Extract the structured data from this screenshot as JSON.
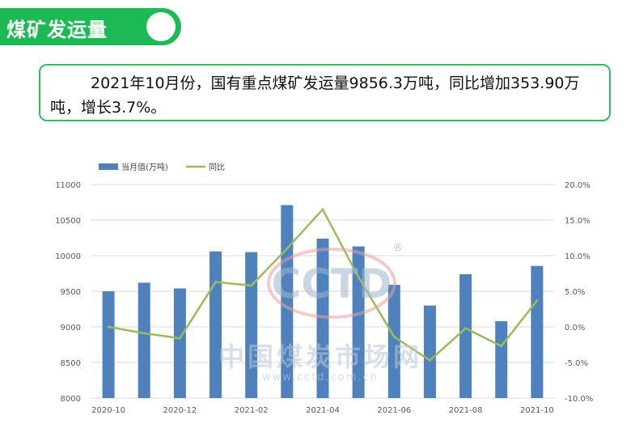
{
  "header": {
    "title": "煤矿发运量"
  },
  "summary": {
    "text": "2021年10月份，国有重点煤矿发运量9856.3万吨，同比增加353.90万吨，增长3.7%。"
  },
  "watermark": {
    "logo_text": "CCTD",
    "registered_mark": "®",
    "cn_text": "中国煤炭市场网",
    "url": "www.cctd.com.cn"
  },
  "colors": {
    "brand_green": "#1db954",
    "bar_blue": "#4f81bd",
    "line_green": "#9bbb59"
  },
  "chart_data": {
    "type": "bar",
    "categories": [
      "2020-10",
      "2020-11",
      "2020-12",
      "2021-01",
      "2021-02",
      "2021-03",
      "2021-04",
      "2021-05",
      "2021-06",
      "2021-07",
      "2021-08",
      "2021-09",
      "2021-10"
    ],
    "x_tick_labels": [
      "2020-10",
      "2020-12",
      "2021-02",
      "2021-04",
      "2021-06",
      "2021-08",
      "2021-10"
    ],
    "series": [
      {
        "name": "当月值(万吨)",
        "type": "bar",
        "axis": "left",
        "values": [
          9500,
          9620,
          9540,
          10060,
          10050,
          10710,
          10240,
          10130,
          9590,
          9300,
          9740,
          9080,
          9856.3
        ]
      },
      {
        "name": "同比",
        "type": "line",
        "axis": "right",
        "values": [
          0.0,
          -0.9,
          -1.6,
          6.3,
          5.8,
          11.0,
          16.5,
          7.0,
          -1.4,
          -4.7,
          -0.2,
          -2.7,
          3.7
        ]
      }
    ],
    "y_left": {
      "ylim": [
        8000,
        11000
      ],
      "ticks": [
        "8000",
        "8500",
        "9000",
        "9500",
        "10000",
        "10500",
        "11000"
      ]
    },
    "y_right": {
      "ylim": [
        -10,
        20
      ],
      "ticks": [
        "-10.0%",
        "-5.0%",
        "0.0%",
        "5.0%",
        "10.0%",
        "15.0%",
        "20.0%"
      ]
    },
    "legend_position": "top-left",
    "grid": true
  }
}
